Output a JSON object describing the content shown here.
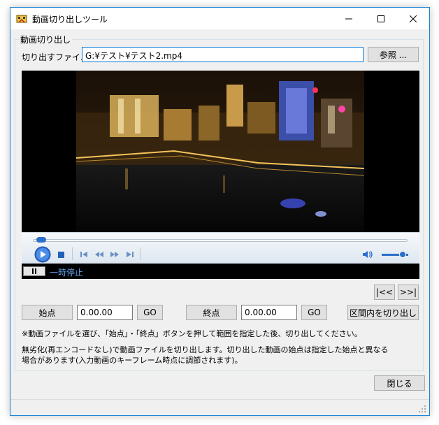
{
  "window": {
    "title": "動画切り出しツール",
    "app_icon": "film-scissors-icon",
    "controls": {
      "minimize_icon": "minimize-icon",
      "maximize_icon": "maximize-icon",
      "close_icon": "close-icon"
    }
  },
  "group": {
    "label": "動画切り出し"
  },
  "file": {
    "label": "切り出すファイル",
    "path": "G:¥テスト¥テスト2.mp4",
    "browse_label": "参照 ..."
  },
  "player": {
    "play_icon": "play-icon",
    "stop_icon": "stop-icon",
    "prev_icon": "skip-previous-icon",
    "rewind_icon": "rewind-icon",
    "forward_icon": "fast-forward-icon",
    "next_icon": "skip-next-icon",
    "volume_icon": "volume-icon",
    "pause_icon": "pause-icon",
    "status": "一時停止",
    "seek_position": 0.01,
    "volume_level": 0.8
  },
  "nav": {
    "jump_start_label": "|<<",
    "jump_end_label": ">>|"
  },
  "range": {
    "start_label": "始点",
    "start_value": "0.00.00",
    "start_go": "GO",
    "end_label": "終点",
    "end_value": "0.00.00",
    "end_go": "GO",
    "cut_label": "区間内を切り出し"
  },
  "notes": {
    "line1": "※動画ファイルを選び、「始点」・「終点」ボタンを押して範囲を指定した後、切り出してください。",
    "line2": "無劣化(再エンコードなし)で動画ファイルを切り出します。切り出した動画の始点は指定した始点と異なる",
    "line3": "場合があります(入力動画のキーフレーム時点に調節されます)。"
  },
  "footer": {
    "close_label": "閉じる"
  },
  "colors": {
    "accent": "#0078d7",
    "status_text": "#5f9fe8",
    "window_border": "#1883d7"
  }
}
